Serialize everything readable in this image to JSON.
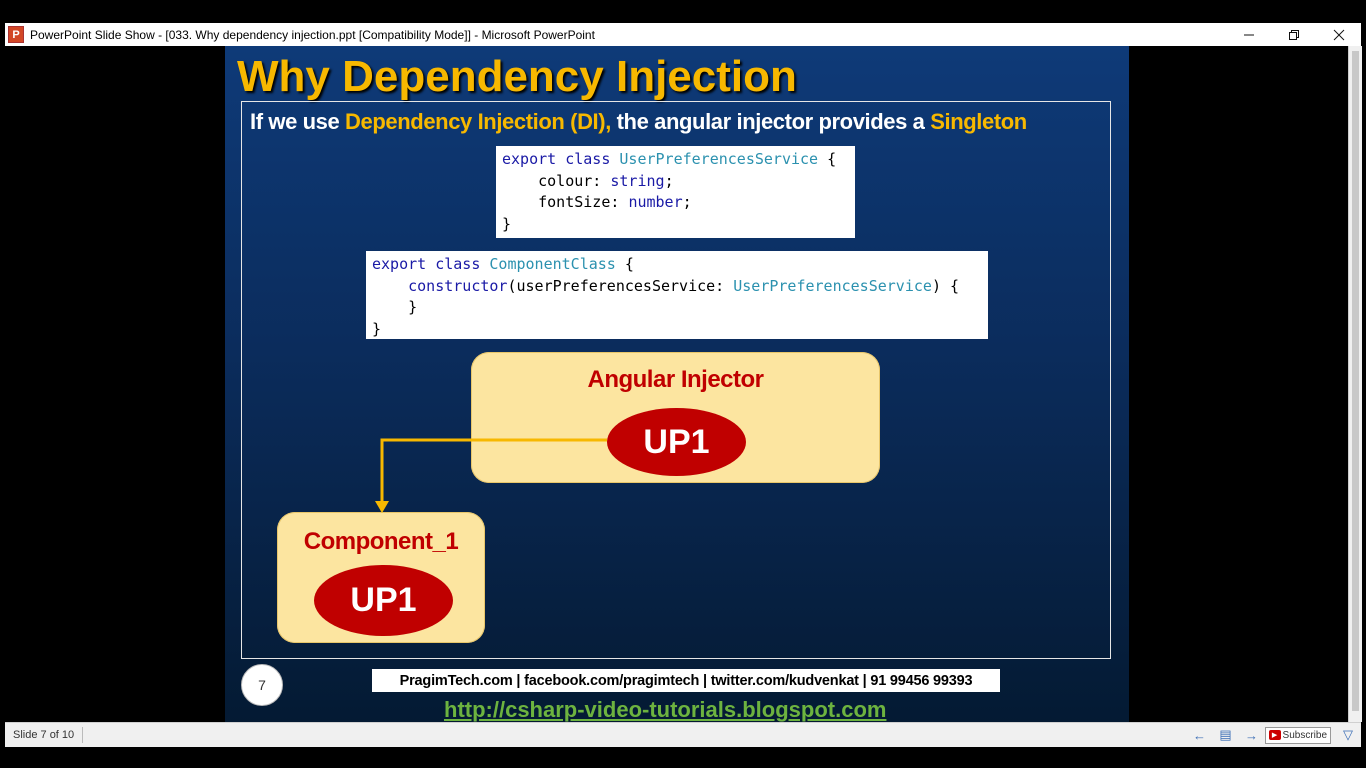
{
  "window": {
    "app_icon": "P",
    "title": "PowerPoint Slide Show - [033. Why dependency injection.ppt [Compatibility Mode]] - Microsoft PowerPoint",
    "minimize_icon": "minimize-icon",
    "restore_icon": "restore-icon",
    "close_icon": "close-icon"
  },
  "slide": {
    "title": "Why Dependency Injection",
    "subtitle": {
      "part1": "If we use ",
      "highlight1": "Dependency Injection (DI),",
      "part2": " the angular injector provides a ",
      "highlight2": "Singleton"
    },
    "code1": {
      "line1_kw": "export class ",
      "line1_type": "UserPreferencesService",
      "line1_rest": " {",
      "line2_name": "    colour: ",
      "line2_type": "string",
      "line2_rest": ";",
      "line3_name": "    fontSize: ",
      "line3_type": "number",
      "line3_rest": ";",
      "line4": "}"
    },
    "code2": {
      "line1_kw": "export class ",
      "line1_type": "ComponentClass",
      "line1_rest": " {",
      "line2_kw": "    constructor",
      "line2_mid": "(userPreferencesService: ",
      "line2_type": "UserPreferencesService",
      "line2_rest": ") {",
      "line3": "    }",
      "line4": "}"
    },
    "injector_label": "Angular Injector",
    "injector_instance": "UP1",
    "component_label": "Component_1",
    "component_instance": "UP1",
    "slide_number": "7",
    "footer_info": "PragimTech.com | facebook.com/pragimtech  | twitter.com/kudvenkat  | 91 99456 99393",
    "footer_link": "http://csharp-video-tutorials.blogspot.com"
  },
  "statusbar": {
    "slide_indicator": "Slide 7 of 10",
    "subscribe_label": "Subscribe"
  },
  "colors": {
    "title": "#f7b800",
    "box_fill": "#fce5a0",
    "ellipse": "#c00000",
    "arrow": "#f7b800",
    "link": "#6db33f"
  }
}
